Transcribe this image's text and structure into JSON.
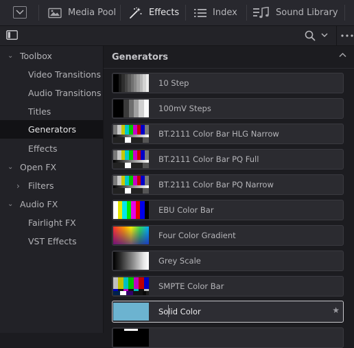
{
  "toolbar": {
    "media_pool": "Media Pool",
    "effects": "Effects",
    "index": "Index",
    "sound_library": "Sound Library"
  },
  "sidebar": {
    "items": [
      {
        "label": "Toolbox",
        "level": 0,
        "expanded": true
      },
      {
        "label": "Video Transitions",
        "level": 1
      },
      {
        "label": "Audio Transitions",
        "level": 1
      },
      {
        "label": "Titles",
        "level": 1
      },
      {
        "label": "Generators",
        "level": 1,
        "selected": true
      },
      {
        "label": "Effects",
        "level": 1
      },
      {
        "label": "Open FX",
        "level": 0,
        "expanded": true
      },
      {
        "label": "Filters",
        "level": 1,
        "expanded": false
      },
      {
        "label": "Audio FX",
        "level": 0,
        "expanded": true
      },
      {
        "label": "Fairlight FX",
        "level": 1
      },
      {
        "label": "VST Effects",
        "level": 1
      }
    ]
  },
  "main": {
    "section_title": "Generators",
    "generators": [
      {
        "label": "10 Step"
      },
      {
        "label": "100mV Steps"
      },
      {
        "label": "BT.2111 Color Bar HLG Narrow"
      },
      {
        "label": "BT.2111 Color Bar PQ Full"
      },
      {
        "label": "BT.2111 Color Bar PQ Narrow"
      },
      {
        "label": "EBU Color Bar"
      },
      {
        "label": "Four Color Gradient"
      },
      {
        "label": "Grey Scale"
      },
      {
        "label": "SMPTE Color Bar"
      },
      {
        "label": "Solid Color",
        "selected": true,
        "swatch": "#6cb3d0"
      }
    ]
  },
  "colors": {
    "selection_border": "#c9c9cd",
    "selected_tree_bg": "#121215"
  }
}
